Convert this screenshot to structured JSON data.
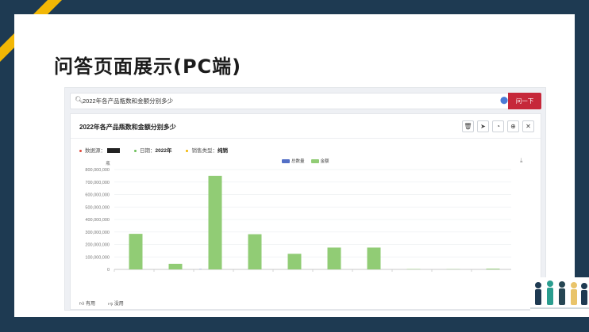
{
  "slide": {
    "title": "问答页面展示(PC端)",
    "accent_color": "#f2b705",
    "frame_color": "#1e3a52"
  },
  "search": {
    "icon": "search-icon",
    "query": "2022年各产品瓶数和金额分别多少",
    "mic_icon": "microphone-icon",
    "ask_button": "问一下",
    "ask_color": "#c6283a"
  },
  "card": {
    "title": "2022年各产品瓶数和金额分别多少",
    "tools": [
      "trash-icon",
      "send-icon",
      "pie-chart-icon",
      "target-icon",
      "close-icon"
    ],
    "tool_glyphs": [
      "🗑",
      "➤",
      "◔",
      "⊕",
      "✕"
    ]
  },
  "filters": [
    {
      "label": "数据源：",
      "value": "",
      "color": "#e0483a"
    },
    {
      "label": "日期：",
      "value": "2022年",
      "color": "#6cbf5a"
    },
    {
      "label": "销售类型：",
      "value": "纯销",
      "color": "#f2b705"
    }
  ],
  "download_icon": "download-icon",
  "chart_data": {
    "type": "bar",
    "ylabel": "瓶",
    "ylim": [
      0,
      800000000
    ],
    "yticks": [
      "0",
      "100,000,000",
      "200,000,000",
      "300,000,000",
      "400,000,000",
      "500,000,000",
      "600,000,000",
      "700,000,000",
      "800,000,000"
    ],
    "categories": [
      "",
      "",
      "",
      "",
      "",
      "",
      "",
      "",
      "",
      ""
    ],
    "series": [
      {
        "name": "总数量",
        "color": "#5470c6",
        "values": [
          0,
          0,
          2000000,
          0,
          0,
          0,
          0,
          0,
          0,
          0
        ]
      },
      {
        "name": "金额",
        "color": "#91cc75",
        "values": [
          285000000,
          45000000,
          750000000,
          282000000,
          125000000,
          175000000,
          175000000,
          3000000,
          2000000,
          6000000
        ]
      }
    ],
    "legend_position": "top-center",
    "grid": true
  },
  "footer": {
    "useful": "有用",
    "useless": "没用"
  }
}
